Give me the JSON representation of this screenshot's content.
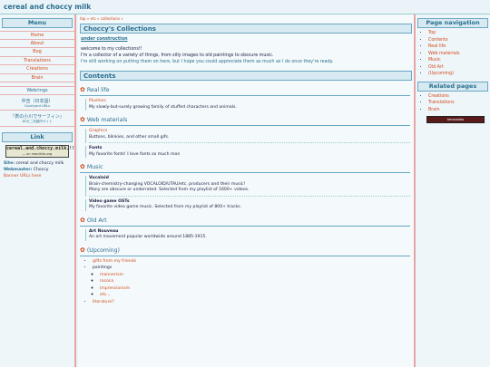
{
  "site": {
    "title": "cereal and choccy milk"
  },
  "left": {
    "menu_header": "Menu",
    "menu": [
      "Home",
      "About",
      "Bog",
      "Translations",
      "Creations",
      "Brain"
    ],
    "webrings_label": "Webrings",
    "webring1": {
      "title": "中吉（日本語）",
      "sub": "Courtyard URLs"
    },
    "webring2": {
      "title": "『表の小川でサーフィン』",
      "sub": "ATの二次創作サイト"
    },
    "link_header": "Link",
    "link_badge": {
      "big": "cereal.and.choccy.milk.!!",
      "small": "— on neocities.org"
    },
    "site_label": "Site:",
    "site_name": "cereal and choccy milk",
    "webmaster_label": "Webmaster:",
    "webmaster_name": "Choccy",
    "banner_urls": "Banner URLs here"
  },
  "main": {
    "breadcrumb": "top » etc » collections »",
    "page_title": "Choccy's Collections",
    "under_construction": "under construction",
    "intro_lines": [
      "welcome to my collections!!",
      "I'm a collector of a variety of things, from silly images to old paintings to obscure music.",
      "I'm still working on putting them on here, but I hope you could appreciate them as much as I do once they're ready."
    ],
    "contents_title": "Contents",
    "sections": [
      {
        "title": "Real life",
        "entries": [
          {
            "title": "Plushies",
            "desc": "My slowly-but-surely growing family of stuffed characters and animals."
          }
        ]
      },
      {
        "title": "Web materials",
        "entries": [
          {
            "title": "Graphics",
            "desc": "Buttons, blinkies, and other small gifs."
          },
          {
            "title": "Fonts",
            "desc": "My favorite fonts! I love fonts so much mon"
          }
        ]
      },
      {
        "title": "Music",
        "entries": [
          {
            "title": "Vocaloid",
            "desc1": "Brain-chemistry-changing VOCALOID/UTAU/etc. producers and their music!",
            "desc2": "Many are obscure or underrated. Selected from my playlist of 1600+ videos."
          },
          {
            "title": "Video game OSTs",
            "desc": "My favorite video game music. Selected from my playlist of 800+ tracks."
          }
        ]
      },
      {
        "title": "Old Art",
        "entries": [
          {
            "title": "Art Nouveau",
            "desc": "An art movement popular worldwide around 1885-1915."
          }
        ]
      },
      {
        "title": "(Upcoming)",
        "items": [
          "gifts from my friends",
          "paintings",
          "literature?"
        ],
        "sub_items": [
          "mannerism",
          "rococo",
          "impressionism",
          "etc..."
        ]
      }
    ]
  },
  "right": {
    "nav_header": "Page navigation",
    "nav": [
      "Top",
      "Contents",
      "Real life",
      "Web materials",
      "Music",
      "Old Art",
      "(Upcoming)"
    ],
    "related_header": "Related pages",
    "related": [
      "Creations",
      "Translations",
      "Brain"
    ],
    "badge": "tetrazoidia"
  },
  "colors": {
    "accent": "#2a6f8f",
    "link": "#d24a1a",
    "border": "#e6a6a6",
    "bg": "#eaf3f7"
  }
}
